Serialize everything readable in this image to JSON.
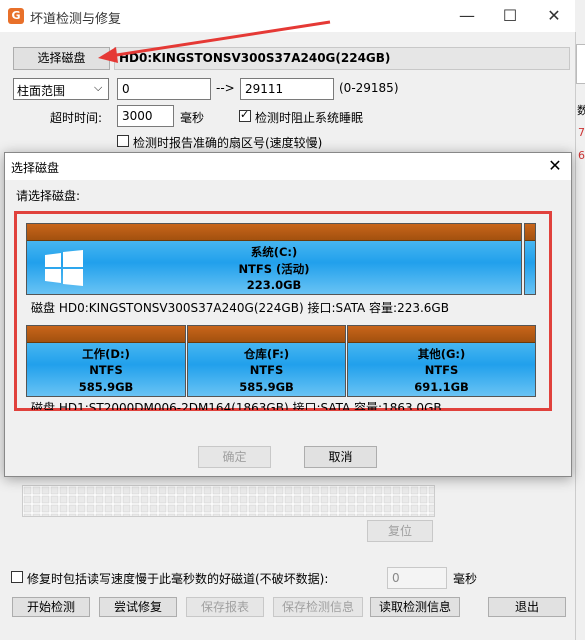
{
  "main": {
    "title": "坏道检测与修复",
    "select_disk_btn": "选择磁盘",
    "disk_name": "HD0:KINGSTONSV300S37A240G(224GB)",
    "range_select": "柱面范围",
    "range_start": "0",
    "range_arrow": "-->",
    "range_end": "29111",
    "range_hint": "(0-29185)",
    "timeout_label": "超时时间:",
    "timeout_value": "3000",
    "timeout_unit": "毫秒",
    "prevent_sleep_label": "检测时阻止系统睡眠",
    "report_sector_label": "检测时报告准确的扇区号(速度较慢)",
    "reset_btn": "复位",
    "repair_option_label": "修复时包括读写速度慢于此毫秒数的好磁道(不破坏数据):",
    "repair_ms_value": "0",
    "repair_ms_unit": "毫秒",
    "buttons": {
      "start": "开始检测",
      "try_repair": "尝试修复",
      "save_report": "保存报表",
      "save_info": "保存检测信息",
      "load_info": "读取检测信息",
      "exit": "退出"
    },
    "side_glyphs": [
      "数",
      "7",
      "6"
    ]
  },
  "dialog": {
    "title": "选择磁盘",
    "prompt": "请选择磁盘:",
    "disk0": {
      "partition": {
        "name": "系统(C:)",
        "fs": "NTFS (活动)",
        "size": "223.0GB"
      },
      "info": "磁盘 HD0:KINGSTONSV300S37A240G(224GB)  接口:SATA  容量:223.6GB"
    },
    "disk1": {
      "partitions": [
        {
          "name": "工作(D:)",
          "fs": "NTFS",
          "size": "585.9GB"
        },
        {
          "name": "仓库(F:)",
          "fs": "NTFS",
          "size": "585.9GB"
        },
        {
          "name": "其他(G:)",
          "fs": "NTFS",
          "size": "691.1GB"
        }
      ],
      "info": "磁盘 HD1:ST2000DM006-2DM164(1863GB)  接口:SATA  容量:1863.0GB"
    },
    "ok_btn": "确定",
    "cancel_btn": "取消"
  },
  "colors": {
    "accent_red": "#e0413c",
    "partition_cap": "#b55a14",
    "partition_fill": "#21a0ec"
  }
}
